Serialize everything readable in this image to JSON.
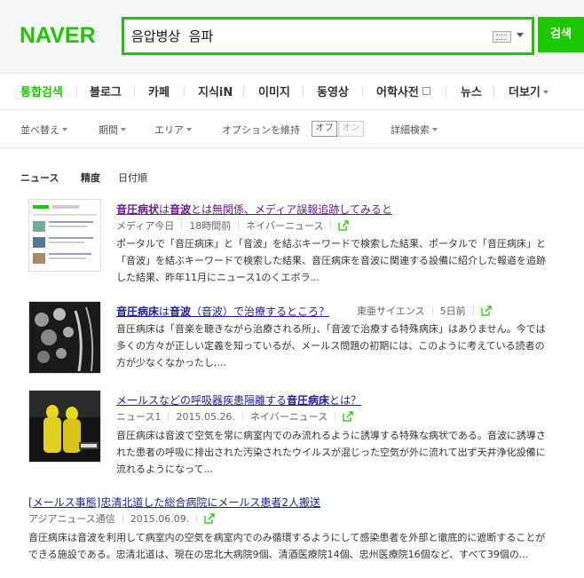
{
  "header": {
    "logo": "NAVER",
    "search_value": "음압병상  음파",
    "search_button": "검색"
  },
  "nav": {
    "items": [
      "통합검색",
      "블로그",
      "카페",
      "지식iN",
      "이미지",
      "동영상",
      "어학사전",
      "뉴스",
      "더보기"
    ]
  },
  "options": {
    "sort": "並べ替え",
    "period": "期間",
    "area": "エリア",
    "keep": "オプションを維持",
    "off": "オフ",
    "on": "オン",
    "detail": "詳細検索"
  },
  "sort_tabs": [
    "ニュース",
    "精度",
    "日付順"
  ],
  "results": [
    {
      "title_pre": "音圧病状",
      "title_mid": "は",
      "title_b2": "音波",
      "title_rest": "とは無関係、メディア誤報追跡してみると",
      "meta": [
        "メディア今日",
        "18時間前",
        "ネイバーニュース"
      ],
      "desc": "ポータルで「音圧病床」と「音波」を結ぶキーワードで検索した結果、ポータルで「音圧病床」と「音波」を結ぶキーワードで検索した結果、音圧病床を音波に関連する設備に紹介した報道を追跡した結果、昨年11月にニュース1のくエボラ..."
    },
    {
      "title_pre": "音圧病床",
      "title_mid": "は",
      "title_b2": "音波",
      "title_rest": "（音波）で治療するところ？",
      "meta": [
        "東亜サイエンス",
        "5日前"
      ],
      "desc": "音圧病床は「音楽を聴きながら治療される所」、「音波で治療する特殊病床」はありません。今では多くの方々が正しい定義を知っているが、メールス問題の初期には、このように考えている読者の方が少なくなかったし,..."
    },
    {
      "title_pre": "",
      "title_mid": "メールスなどの呼吸器疾患隔離する",
      "title_b2": "音圧病床",
      "title_rest": "とは？",
      "meta": [
        "ニュース1",
        "2015.05.26.",
        "ネイバーニュース"
      ],
      "desc": "音圧病床は音波で空気を常に病室内でのみ流れるように誘導する特殊な病状である。音波に誘導された患者の呼吸に排出された汚染されたウイルスが混じった空気が外に流れて出ず天井浄化設備に流れるようになって..."
    },
    {
      "title_pre": "",
      "title_mid": "[メールス事態]忠清北道した総合病院にメールス患者2人搬送",
      "title_b2": "",
      "title_rest": "",
      "meta": [
        "アジアニュース通信",
        "2015.06.09."
      ],
      "desc": "音圧病床は音波を利用して病室内の空気を病室内でのみ循環するようにして感染患者を外部と徹底的に遮断することができる施設である。忠清北道は、現在の忠北大病院9個、清酒医療院14個、忠州医療院16個など、すべて39個の..."
    }
  ],
  "colors": {
    "brand": "#1ec800",
    "link": "#1f1f9a"
  }
}
